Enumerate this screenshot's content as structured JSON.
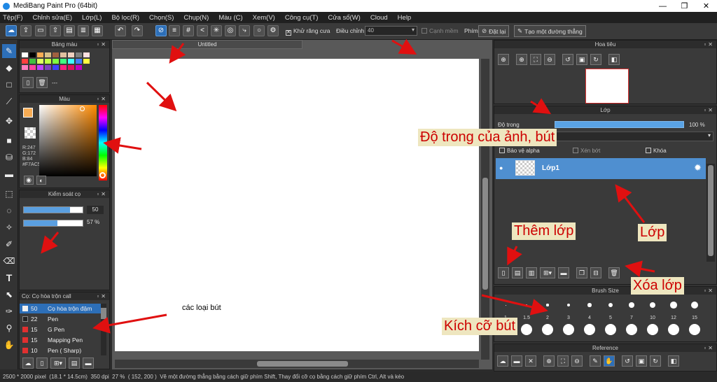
{
  "window": {
    "title": "MediBang Paint Pro (64bit)",
    "min": "—",
    "max": "❐",
    "close": "✕"
  },
  "menu": [
    "Tệp(F)",
    "Chỉnh sửa(E)",
    "Lớp(L)",
    "Bộ lọc(R)",
    "Chọn(S)",
    "Chụp(N)",
    "Màu (C)",
    "Xem(V)",
    "Công cụ(T)",
    "Cửa sổ(W)",
    "Cloud",
    "Help"
  ],
  "toolbar": {
    "antialias_label": "Khử răng cưa",
    "adjust_label": "Điều chỉnh",
    "adjust_value": "40",
    "edge_label": "Cạnh mềm",
    "ruler_label": "Phím",
    "reset_label": "Đặt lại",
    "create_line_label": "Tạo một đường thẳng"
  },
  "canvas": {
    "tab_title": "Untitled"
  },
  "panels": {
    "palette_title": "Bảng màu",
    "palette_more": "---",
    "color_title": "Màu",
    "color_rgb": {
      "r": "R:247",
      "g": "G:172",
      "b": "B:84",
      "hex": "#F7AC54"
    },
    "brush_control_title": "Kiểm soát cọ",
    "brush_size_value": "50",
    "brush_opacity_value": "57 %",
    "brush_list_title": "Cọ: Cọ hòa trộn call",
    "brushes": [
      {
        "size": "50",
        "name": "Cọ hòa trộn đậm",
        "color": "#f0f0f0"
      },
      {
        "size": "22",
        "name": "Pen",
        "color": "#222222"
      },
      {
        "size": "15",
        "name": "G Pen",
        "color": "#e03030"
      },
      {
        "size": "15",
        "name": "Mapping Pen",
        "color": "#e03030"
      },
      {
        "size": "10",
        "name": "Pen ( Sharp)",
        "color": "#e03030"
      }
    ],
    "navigator_title": "Hoa tiêu",
    "layer_title": "Lớp",
    "opacity_label": "Độ trong",
    "opacity_value": "100 %",
    "protect_alpha": "Bảo vệ alpha",
    "clip": "Xén bớt",
    "lock": "Khóa",
    "layer_name": "Lớp1",
    "brush_size_title": "Brush Size",
    "brush_sizes": [
      "1",
      "1.5",
      "2",
      "3",
      "4",
      "5",
      "7",
      "10",
      "12",
      "15"
    ],
    "reference_title": "Reference"
  },
  "annotations": {
    "brush_types": "các loại bút",
    "opacity_note": "Độ trong của ảnh, bút",
    "add_layer": "Thêm lớp",
    "layer": "Lớp",
    "delete_layer": "Xóa lớp",
    "brush_size": "Kích cỡ bút"
  },
  "status": {
    "size": "2500 * 2000 pixel",
    "cm": "(18.1 * 14.5cm)",
    "dpi": "350 dpi",
    "zoom": "27 %",
    "coords": "( 152, 200 )",
    "hint": "Vẽ một đường thẳng bằng cách giữ phím Shift, Thay đổi cỡ cọ bằng cách giữ phím Ctrl, Alt và kéo"
  },
  "colors": {
    "accent": "#2d6fb8",
    "annotation": "#cc0000",
    "foreground": "#F7AC54",
    "secondary": "#1aa89a"
  }
}
